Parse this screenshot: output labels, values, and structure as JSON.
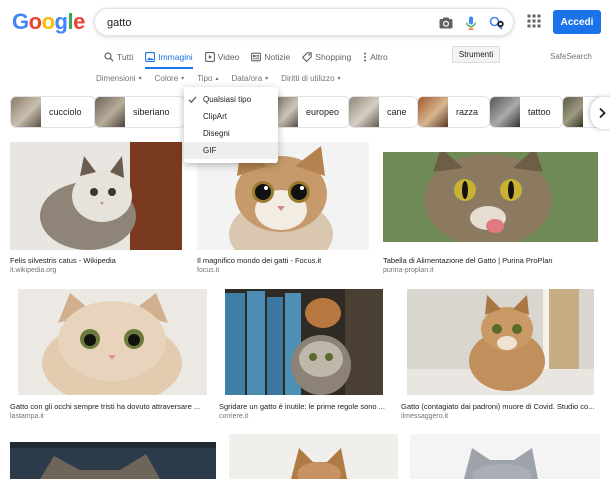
{
  "header": {
    "logo_letters": [
      {
        "ch": "G",
        "color": "#4285F4"
      },
      {
        "ch": "o",
        "color": "#EA4335"
      },
      {
        "ch": "o",
        "color": "#FBBC05"
      },
      {
        "ch": "g",
        "color": "#4285F4"
      },
      {
        "ch": "l",
        "color": "#34A853"
      },
      {
        "ch": "e",
        "color": "#EA4335"
      }
    ],
    "search_value": "gatto",
    "icons": [
      "camera-icon",
      "microphone-icon",
      "lens-icon",
      "apps-icon"
    ],
    "signin_label": "Accedi",
    "accent": "#1a73e8"
  },
  "tabs": [
    {
      "label": "Tutti",
      "icon": "search-icon",
      "active": false
    },
    {
      "label": "Immagini",
      "icon": "image-icon",
      "active": true
    },
    {
      "label": "Video",
      "icon": "video-icon",
      "active": false
    },
    {
      "label": "Notizie",
      "icon": "news-icon",
      "active": false
    },
    {
      "label": "Shopping",
      "icon": "tag-icon",
      "active": false
    },
    {
      "label": "Altro",
      "icon": "more-icon",
      "active": false
    }
  ],
  "tools_label": "Strumenti",
  "safesearch_label": "SafeSearch",
  "filters": [
    {
      "label": "Dimensioni",
      "caret": "▾"
    },
    {
      "label": "Colore",
      "caret": "▾"
    },
    {
      "label": "Tipo",
      "caret": "▴"
    },
    {
      "label": "Data/ora",
      "caret": "▾"
    },
    {
      "label": "Diritti di utilizzo",
      "caret": "▾"
    }
  ],
  "chips": [
    {
      "label": "cucciolo"
    },
    {
      "label": "siberiano"
    },
    {
      "label": "europeo"
    },
    {
      "label": "cane"
    },
    {
      "label": "razza"
    },
    {
      "label": "tattoo"
    },
    {
      "label": ""
    }
  ],
  "tipo_menu": {
    "items": [
      {
        "label": "Qualsiasi tipo",
        "checked": true,
        "highlighted": false
      },
      {
        "label": "ClipArt",
        "checked": false,
        "highlighted": false
      },
      {
        "label": "Disegni",
        "checked": false,
        "highlighted": false
      },
      {
        "label": "GIF",
        "checked": false,
        "highlighted": true
      }
    ]
  },
  "results": [
    {
      "caption": "Felis silvestris catus - Wikipedia",
      "source": "it.wikipedia.org"
    },
    {
      "caption": "Il magnifico mondo dei gatti - Focus.it",
      "source": "focus.it"
    },
    {
      "caption": "Tabella di Alimentazione del Gatto | Purina ProPlan",
      "source": "purina-proplan.it"
    },
    {
      "caption": "Gatto con gli occhi sempre tristi ha dovuto attraversare ...",
      "source": "lastampa.it"
    },
    {
      "caption": "Sgridare un gatto è inutile: le prime regole sono ...",
      "source": "corriere.it"
    },
    {
      "caption": "Gatto (contagiato dai padroni) muore di Covid. Studio co...",
      "source": "ilmessaggero.it"
    },
    {
      "caption": "",
      "source": ""
    },
    {
      "caption": "",
      "source": ""
    },
    {
      "caption": "",
      "source": ""
    }
  ]
}
